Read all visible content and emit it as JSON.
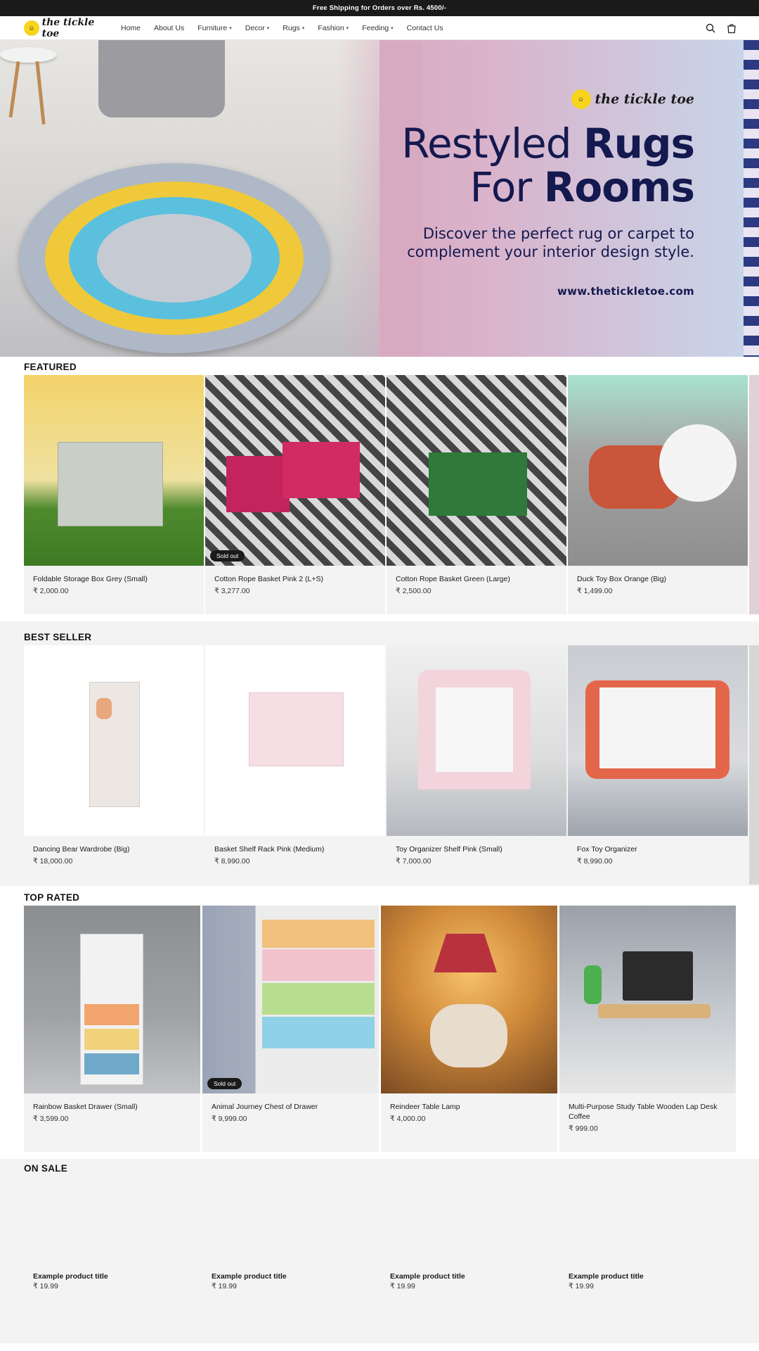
{
  "announcement": "Free Shipping for Orders over Rs. 4500/-",
  "brand": {
    "name": "the tickle toe"
  },
  "nav": [
    {
      "label": "Home",
      "dropdown": false
    },
    {
      "label": "About Us",
      "dropdown": false
    },
    {
      "label": "Furniture",
      "dropdown": true
    },
    {
      "label": "Decor",
      "dropdown": true
    },
    {
      "label": "Rugs",
      "dropdown": true
    },
    {
      "label": "Fashion",
      "dropdown": true
    },
    {
      "label": "Feeding",
      "dropdown": true
    },
    {
      "label": "Contact Us",
      "dropdown": false
    }
  ],
  "hero": {
    "brand": "the tickle toe",
    "line1_light": "Restyled ",
    "line1_bold": "Rugs",
    "line2_light": "For ",
    "line2_bold": "Rooms",
    "subtitle_1": "Discover the perfect rug or carpet to",
    "subtitle_2": "complement your interior design style.",
    "url": "www.thetickletoe.com"
  },
  "sections": {
    "featured": {
      "title": "FEATURED",
      "products": [
        {
          "name": "Foldable Storage Box Grey (Small)",
          "price": "₹ 2,000.00",
          "badge": ""
        },
        {
          "name": "Cotton Rope Basket Pink 2 (L+S)",
          "price": "₹ 3,277.00",
          "badge": "Sold out"
        },
        {
          "name": "Cotton Rope Basket Green (Large)",
          "price": "₹ 2,500.00",
          "badge": ""
        },
        {
          "name": "Duck Toy Box Orange (Big)",
          "price": "₹ 1,499.00",
          "badge": ""
        }
      ]
    },
    "best_seller": {
      "title": "BEST SELLER",
      "products": [
        {
          "name": "Dancing Bear Wardrobe (Big)",
          "price": "₹ 18,000.00",
          "badge": ""
        },
        {
          "name": "Basket Shelf Rack Pink (Medium)",
          "price": "₹ 8,990.00",
          "badge": ""
        },
        {
          "name": "Toy Organizer Shelf Pink (Small)",
          "price": "₹ 7,000.00",
          "badge": ""
        },
        {
          "name": "Fox Toy Organizer",
          "price": "₹ 8,990.00",
          "badge": ""
        }
      ]
    },
    "top_rated": {
      "title": "TOP RATED",
      "products": [
        {
          "name": "Rainbow Basket Drawer (Small)",
          "price": "₹ 3,599.00",
          "badge": ""
        },
        {
          "name": "Animal Journey Chest of Drawer",
          "price": "₹ 9,999.00",
          "badge": "Sold out"
        },
        {
          "name": "Reindeer Table Lamp",
          "price": "₹ 4,000.00",
          "badge": ""
        },
        {
          "name": "Multi-Purpose Study Table Wooden Lap Desk Coffee",
          "price": "₹ 999.00",
          "badge": ""
        }
      ]
    },
    "on_sale": {
      "title": "ON SALE",
      "products": [
        {
          "name": "Example product title",
          "price": "₹ 19.99"
        },
        {
          "name": "Example product title",
          "price": "₹ 19.99"
        },
        {
          "name": "Example product title",
          "price": "₹ 19.99"
        },
        {
          "name": "Example product title",
          "price": "₹ 19.99"
        }
      ]
    }
  },
  "icons": {
    "search": "search-icon",
    "cart": "cart-icon",
    "chevron": "chevron-down-icon"
  },
  "colors": {
    "announcement_bg": "#1a1a1a",
    "hero_text": "#14194f",
    "card_bg": "#f3f3f3",
    "badge_bg": "#1a1a1a"
  }
}
